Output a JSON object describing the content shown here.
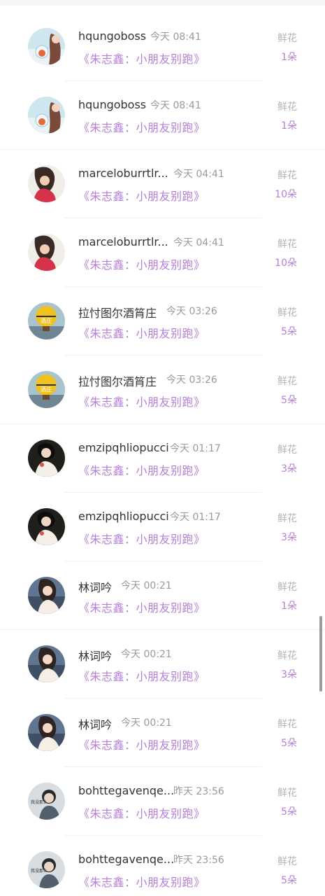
{
  "header": {},
  "gift_unit": "鲜花",
  "colors": {
    "accent": "#b57fd6",
    "muted": "#9a9a9a"
  },
  "rows": [
    {
      "avatar": "avatar-tea-girl-icon",
      "username": "hqungoboss",
      "time": "今天 08:41",
      "song": "《朱志鑫：小朋友别跑》",
      "gift": "鲜花",
      "count": "1朵"
    },
    {
      "avatar": "avatar-tea-girl-icon",
      "username": "hqungoboss",
      "time": "今天 08:41",
      "song": "《朱志鑫：小朋友别跑》",
      "gift": "鲜花",
      "count": "1朵"
    },
    {
      "avatar": "avatar-red-dress-icon",
      "username": "marceloburrtlr...",
      "time": "今天 04:41",
      "song": "《朱志鑫：小朋友别跑》",
      "gift": "鲜花",
      "count": "10朵"
    },
    {
      "avatar": "avatar-red-dress-icon",
      "username": "marceloburrtlr...",
      "time": "今天 04:41",
      "song": "《朱志鑫：小朋友别跑》",
      "gift": "鲜花",
      "count": "10朵"
    },
    {
      "avatar": "avatar-balloon-icon",
      "username": "拉忖图尔酒筲庄",
      "time": "今天 03:26",
      "song": "《朱志鑫：小朋友别跑》",
      "gift": "鲜花",
      "count": "5朵"
    },
    {
      "avatar": "avatar-balloon-icon",
      "username": "拉忖图尔酒筲庄",
      "time": "今天 03:26",
      "song": "《朱志鑫：小朋友别跑》",
      "gift": "鲜花",
      "count": "5朵"
    },
    {
      "avatar": "avatar-white-dress-icon",
      "username": "emzipqhliopucci",
      "time": "今天 01:17",
      "song": "《朱志鑫：小朋友别跑》",
      "gift": "鲜花",
      "count": "3朵"
    },
    {
      "avatar": "avatar-white-dress-icon",
      "username": "emzipqhliopucci",
      "time": "今天 01:17",
      "song": "《朱志鑫：小朋友别跑》",
      "gift": "鲜花",
      "count": "3朵"
    },
    {
      "avatar": "avatar-seaside-girl-icon",
      "username": "林词吟",
      "time": "今天 00:21",
      "song": "《朱志鑫：小朋友别跑》",
      "gift": "鲜花",
      "count": "1朵"
    },
    {
      "avatar": "avatar-seaside-girl-icon",
      "username": "林词吟",
      "time": "今天 00:21",
      "song": "《朱志鑫：小朋友别跑》",
      "gift": "鲜花",
      "count": "3朵"
    },
    {
      "avatar": "avatar-seaside-girl-icon",
      "username": "林词吟",
      "time": "今天 00:21",
      "song": "《朱志鑫：小朋友别跑》",
      "gift": "鲜花",
      "count": "5朵"
    },
    {
      "avatar": "avatar-meme-kid-icon",
      "username": "bohttegavenqe...",
      "time": "昨天 23:56",
      "song": "《朱志鑫：小朋友别跑》",
      "gift": "鲜花",
      "count": "5朵"
    },
    {
      "avatar": "avatar-meme-kid-icon",
      "username": "bohttegavenqe...",
      "time": "昨天 23:56",
      "song": "《朱志鑫：小朋友别跑》",
      "gift": "鲜花",
      "count": "5朵"
    }
  ]
}
